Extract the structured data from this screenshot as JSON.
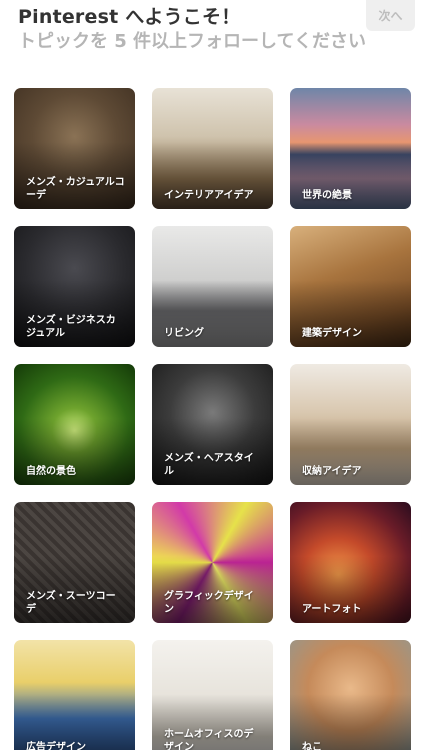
{
  "header": {
    "title": "Pinterest へようこそ！",
    "subtitle": "トピックを 5 件以上フォローしてください",
    "next_label": "次へ"
  },
  "topics": [
    {
      "label": "メンズ・カジュアルコーデ",
      "image": "mens-casual-photo"
    },
    {
      "label": "インテリアアイデア",
      "image": "interior-photo"
    },
    {
      "label": "世界の絶景",
      "image": "world-scenery-photo"
    },
    {
      "label": "メンズ・ビジネスカジュアル",
      "image": "mens-business-photo"
    },
    {
      "label": "リビング",
      "image": "living-room-photo"
    },
    {
      "label": "建築デザイン",
      "image": "architecture-photo"
    },
    {
      "label": "自然の景色",
      "image": "nature-photo"
    },
    {
      "label": "メンズ・ヘアスタイル",
      "image": "mens-hair-photo"
    },
    {
      "label": "収納アイデア",
      "image": "storage-photo"
    },
    {
      "label": "メンズ・スーツコーデ",
      "image": "mens-suit-photo"
    },
    {
      "label": "グラフィックデザイン",
      "image": "graphic-design-image"
    },
    {
      "label": "アートフォト",
      "image": "art-photo"
    },
    {
      "label": "広告デザイン",
      "image": "ad-design-image"
    },
    {
      "label": "ホームオフィスのデザイン",
      "image": "home-office-photo"
    },
    {
      "label": "ねこ",
      "image": "cat-photo"
    }
  ]
}
